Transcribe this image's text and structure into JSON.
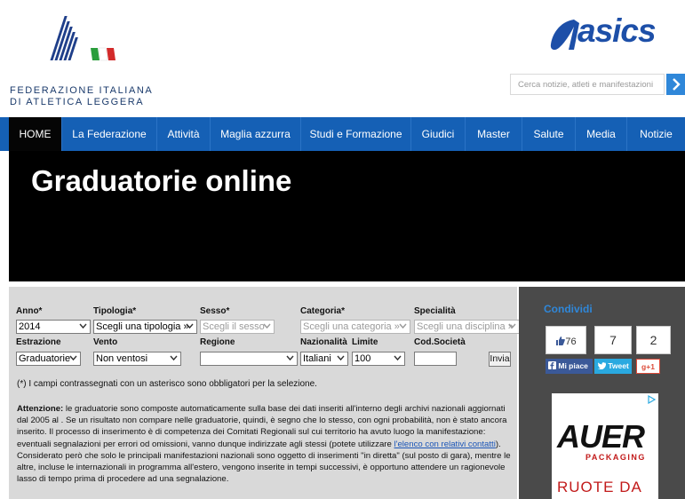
{
  "header": {
    "federation_line1": "FEDERAZIONE ITALIANA",
    "federation_line2": "DI ATLETICA LEGGERA",
    "sponsor": "asics",
    "search_placeholder": "Cerca notizie, atleti e manifestazioni"
  },
  "nav": {
    "items": [
      {
        "label": "HOME",
        "active": true
      },
      {
        "label": "La Federazione"
      },
      {
        "label": "Attività"
      },
      {
        "label": "Maglia azzurra"
      },
      {
        "label": "Studi e Formazione"
      },
      {
        "label": "Giudici"
      },
      {
        "label": "Master"
      },
      {
        "label": "Salute"
      },
      {
        "label": "Media"
      },
      {
        "label": "Notizie"
      }
    ]
  },
  "banner": {
    "title": "Graduatorie online"
  },
  "form": {
    "anno": {
      "label": "Anno*",
      "value": "2014"
    },
    "tipologia": {
      "label": "Tipologia*",
      "value": "Scegli una tipologia »"
    },
    "sesso": {
      "label": "Sesso*",
      "value": "Scegli il sesso"
    },
    "categoria": {
      "label": "Categoria*",
      "value": "Scegli una categoria »"
    },
    "specialita": {
      "label": "Specialità",
      "value": "Scegli una disciplina »"
    },
    "estrazione": {
      "label": "Estrazione",
      "value": "Graduatorie"
    },
    "vento": {
      "label": "Vento",
      "value": "Non ventosi"
    },
    "regione": {
      "label": "Regione",
      "value": ""
    },
    "nazionalita": {
      "label": "Nazionalità",
      "value": "Italiani"
    },
    "limite": {
      "label": "Limite",
      "value": "100"
    },
    "cod_societa": {
      "label": "Cod.Società",
      "value": ""
    },
    "submit": "Invia",
    "required_note": "(*) I campi contrassegnati con un asterisco sono obbligatori per la selezione.",
    "attention_title": "Attenzione:",
    "attention_text_1": " le graduatorie sono composte automaticamente sulla base dei dati inseriti all'interno degli archivi nazionali aggiornati dal 2005 al . Se un risultato non compare nelle graduatorie, quindi, è segno che lo stesso, con ogni probabilità, non è stato ancora inserito. Il processo di inserimento è di competenza dei Comitati Regionali sul cui territorio ha avuto luogo la manifestazione: eventuali segnalazioni per errori od omissioni, vanno dunque indirizzate agli stessi (potete utilizzare ",
    "attention_link": "l'elenco con relativi contatti",
    "attention_text_2": "). Considerato però che solo le principali manifestazioni nazionali sono oggetto di inserimenti \"in diretta\" (sul posto di gara), mentre le altre, incluse le internazionali in programma all'estero, vengono inserite in tempi successivi, è opportuno attendere un ragionevole lasso di tempo prima di procedere ad una segnalazione."
  },
  "sidebar": {
    "title": "Condividi",
    "fb_count": "76",
    "tw_count": "7",
    "gp_count": "2",
    "fb_label": "Mi piace",
    "tw_label": "Tweet",
    "gp_label": "+1",
    "ad_brand": "AUER",
    "ad_sub": "PACKAGING",
    "ad_text": "RUOTE DA"
  },
  "colors": {
    "nav_blue": "#1560b5",
    "banner_black": "#000000",
    "form_gray": "#d9d9d9",
    "sidebar_gray": "#4a4a4a",
    "asics_blue": "#1d4fa8",
    "fb_blue": "#3b5998",
    "tw_blue": "#2aa9e0",
    "gp_red": "#dd4b39"
  }
}
